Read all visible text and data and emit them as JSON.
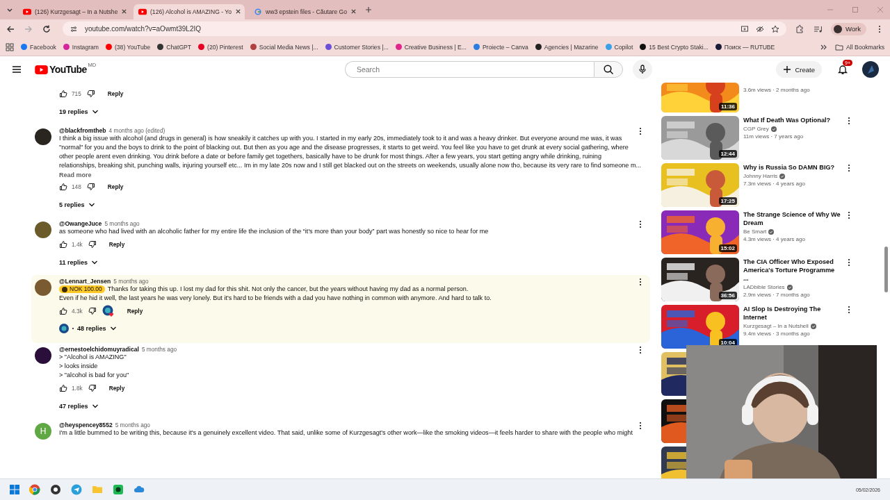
{
  "browser": {
    "tabs": [
      {
        "title": "(126) Kurzgesagt – In a Nutshe",
        "kind": "youtube",
        "selected": false
      },
      {
        "title": "(126) Alcohol is AMAZING - Yo",
        "kind": "youtube",
        "selected": true
      },
      {
        "title": "ww3 epstein files - Căutare Go",
        "kind": "google",
        "selected": false
      }
    ],
    "url": "youtube.com/watch?v=aOwmt39L2IQ",
    "profile": "Work",
    "bookmarks": [
      {
        "label": "Facebook",
        "color": "#1877f2"
      },
      {
        "label": "Instagram",
        "color": "#d6249f"
      },
      {
        "label": "(38) YouTube",
        "color": "#ff0000"
      },
      {
        "label": "ChatGPT",
        "color": "#333333"
      },
      {
        "label": "(20) Pinterest",
        "color": "#e60023"
      },
      {
        "label": "Social Media News |...",
        "color": "#b0413e"
      },
      {
        "label": "Customer Stories |...",
        "color": "#6b4fd8"
      },
      {
        "label": "Creative Business | E...",
        "color": "#e0268a"
      },
      {
        "label": "Proiecte – Canva",
        "color": "#2a7de1"
      },
      {
        "label": "Agencies | Mazarine",
        "color": "#222222"
      },
      {
        "label": "Copilot",
        "color": "#3aa0e8"
      },
      {
        "label": "15 Best Crypto Staki...",
        "color": "#111111"
      },
      {
        "label": "Поиск — RUTUBE",
        "color": "#1a1a3a"
      }
    ],
    "all_bookmarks": "All Bookmarks"
  },
  "youtube": {
    "logo": "YouTube",
    "country": "MD",
    "search": {
      "placeholder": "Search"
    },
    "create": "Create",
    "notifications": "9+"
  },
  "comments": [
    {
      "likes": "715",
      "reply": "Reply",
      "replies": "19 replies",
      "highlighted": false,
      "creator_hearted": false,
      "creator_replied": false
    },
    {
      "author": "@blackfromtheb",
      "time": "4 months ago (edited)",
      "avatar": {
        "color": "#2b2520"
      },
      "lines": [
        "I think a big issue with alcohol (and drugs in general) is how sneakily it catches up with you. I started in my early 20s, immediately took to it and was a heavy drinker. But everyone around me was, it was",
        "\"normal\" for you and the boys to drink to the point of blacking out. But then as you age and the disease progresses, it starts to get weird. You feel like you have to get drunk at every social gathering, where",
        "other people arent even drinking. You drink before a date or before family get togethers, basically have to be drunk for most things. After a few years, you start getting angry while drinking, ruining",
        "relationships, breaking shit, punching walls, injuring yourself etc... Im in my late 20s now and I still get blacked out on the streets on weekends, usually alone now tho, because its very rare to find someone m..."
      ],
      "read_more": "Read more",
      "likes": "148",
      "reply": "Reply",
      "replies": "5 replies",
      "highlighted": false,
      "creator_hearted": false,
      "creator_replied": false
    },
    {
      "author": "@OwangeJuce",
      "time": "5 months ago",
      "avatar": {
        "color": "#6b5a2a"
      },
      "lines": [
        "as someone who had lived with an alcoholic father for my entire life the inclusion of the “it's more than your body” part was honestly so nice to hear for me"
      ],
      "likes": "1.4k",
      "reply": "Reply",
      "replies": "11 replies",
      "highlighted": false,
      "creator_hearted": false,
      "creator_replied": false
    },
    {
      "author": "@Lennart_Jensen",
      "time": "5 months ago",
      "avatar": {
        "color": "#7a5a30"
      },
      "badge": "NOK 100.00",
      "lines": [
        "Thanks for taking this up. I lost my dad for this shit. Not only the cancer, but the years without having my dad as a normal person.",
        "Even if he hid it well, the last years he was very lonely. But it's hard to be friends with a dad you have nothing in common with anymore. And hard to talk to."
      ],
      "likes": "4.3k",
      "reply": "Reply",
      "replies": "48 replies",
      "highlighted": true,
      "creator_hearted": true,
      "creator_replied": true
    },
    {
      "author": "@ernestoelchidomuyradical",
      "time": "5 months ago",
      "avatar": {
        "color": "#2a0f3a"
      },
      "lines": [
        "> \"Alcohol is AMAZING\"",
        "> looks inside",
        "> \"alcohol is bad for you\""
      ],
      "likes": "1.8k",
      "reply": "Reply",
      "replies": "47 replies",
      "highlighted": false,
      "creator_hearted": false,
      "creator_replied": false
    },
    {
      "author": "@heyspencey8552",
      "time": "5 months ago",
      "avatar": {
        "color": "#5fa843",
        "letter": "H"
      },
      "lines": [
        "I'm a little bummed to be writing this, because it's a genuinely excellent video. That said, unlike some of Kurzgesagt's other work—like the smoking videos—it feels harder to share with the people who might"
      ],
      "highlighted": false,
      "creator_hearted": false,
      "creator_replied": false
    }
  ],
  "sidebar": [
    {
      "kind": "video",
      "duration": "11:36",
      "meta": "3.6m views · 2 months ago"
    },
    {
      "kind": "video",
      "title": "What If Death Was Optional?",
      "channel": "CGP Grey",
      "verified": true,
      "meta": "11m views · 7 years ago",
      "duration": "12:44"
    },
    {
      "kind": "video",
      "title": "Why is Russia So DAMN BIG?",
      "channel": "Johnny Harris",
      "verified": true,
      "meta": "7.3m views · 4 years ago",
      "duration": "17:25"
    },
    {
      "kind": "video",
      "title": "The Strange Science of Why We Dream",
      "channel": "Be Smart",
      "verified": true,
      "meta": "4.3m views · 4 years ago",
      "duration": "15:02"
    },
    {
      "kind": "video",
      "title": "The CIA Officer Who Exposed America's Torture Programme ...",
      "channel": "LADbible Stories",
      "verified": true,
      "meta": "2.9m views · 7 months ago",
      "duration": "36:56"
    },
    {
      "kind": "video",
      "title": "AI Slop Is Destroying The Internet",
      "channel": "Kurzgesagt – In a Nutshell",
      "verified": true,
      "meta": "9.4m views · 3 months ago",
      "duration": "10:04"
    },
    {
      "kind": "picture"
    },
    {
      "kind": "picture"
    },
    {
      "kind": "picture"
    }
  ],
  "taskbar": {
    "date": "05/02/2026"
  }
}
